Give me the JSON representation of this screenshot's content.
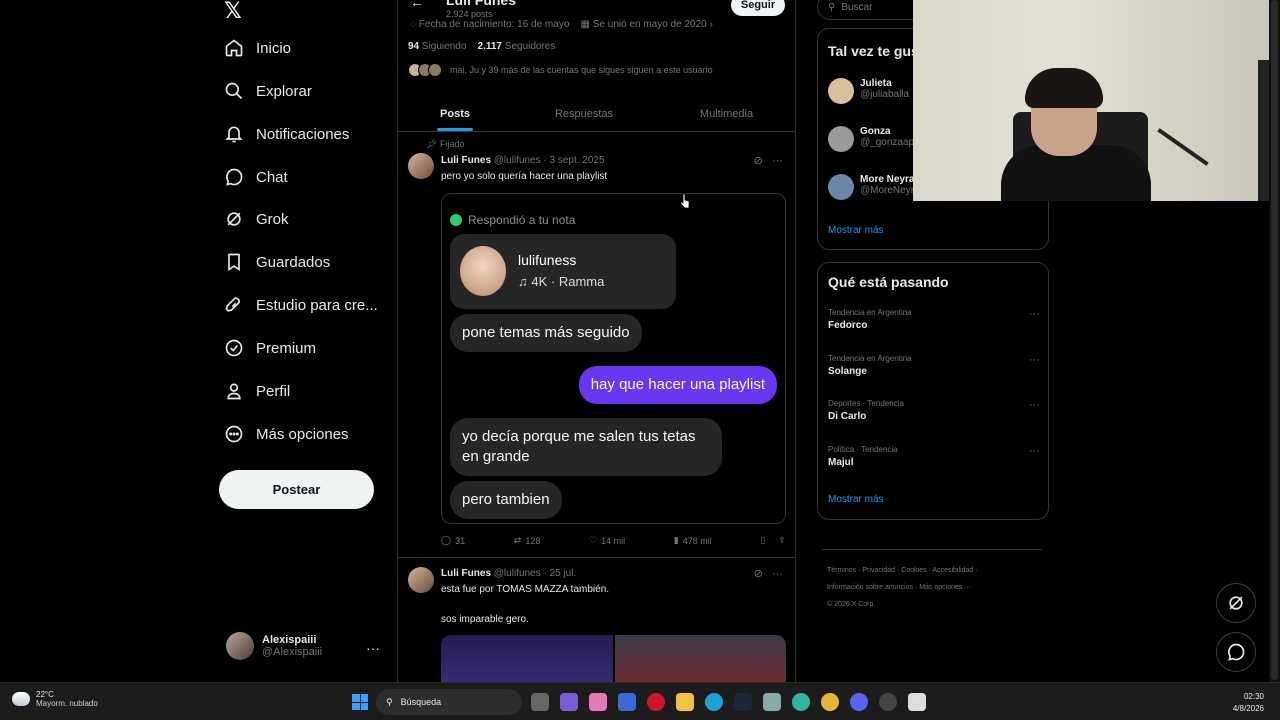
{
  "nav": {
    "items": [
      {
        "label": "Inicio",
        "icon": "home-icon"
      },
      {
        "label": "Explorar",
        "icon": "search-icon"
      },
      {
        "label": "Notificaciones",
        "icon": "bell-icon"
      },
      {
        "label": "Chat",
        "icon": "chat-icon"
      },
      {
        "label": "Grok",
        "icon": "grok-icon"
      },
      {
        "label": "Guardados",
        "icon": "bookmark-icon"
      },
      {
        "label": "Estudio para cre...",
        "icon": "rocket-icon"
      },
      {
        "label": "Premium",
        "icon": "verified-icon"
      },
      {
        "label": "Perfil",
        "icon": "person-icon"
      },
      {
        "label": "Más opciones",
        "icon": "more-circle-icon"
      }
    ],
    "post_button": "Postear",
    "account": {
      "name": "Alexispaiii",
      "handle": "@Alexispaiii"
    }
  },
  "profile": {
    "name": "Luli Funes",
    "post_count": "2.924 posts",
    "follow_label": "Seguir",
    "birth": "Fecha de nacimiento: 16 de mayo",
    "joined": "Se unió en mayo de 2020",
    "following_count": "94",
    "following_label": "Siguiendo",
    "followers_count": "2.117",
    "followers_label": "Seguidores",
    "known_followers": "mai, Ju y 39 más de las cuentas que sigues siguen a este usuario"
  },
  "tabs": [
    "Posts",
    "Respuestas",
    "Multimedia"
  ],
  "pinned_label": "Fijado",
  "post1": {
    "name": "Luli Funes",
    "handle_date": "@lulifunes · 3 sept. 2025",
    "text": "pero yo solo quería hacer una playlist",
    "media": {
      "replied": "Respondió a tu nota",
      "note_user": "lulifuness",
      "note_song": "4K · Ramma",
      "msg1": "pone temas más seguido",
      "msg2": "hay que hacer una playlist",
      "msg3": "yo decía porque me salen tus tetas en grande",
      "msg4": "pero tambien"
    },
    "replies": "31",
    "reposts": "128",
    "likes": "14 mil",
    "views": "478 mil"
  },
  "post2": {
    "name": "Luli Funes",
    "handle_date": "@lulifunes · 25 jul.",
    "text1": "esta fue por TOMAS MAZZA también.",
    "text2": "sos imparable gero."
  },
  "right": {
    "search_placeholder": "Buscar",
    "suggestions_title": "Tal vez te gus",
    "suggestions": [
      {
        "name": "Julieta",
        "handle": "@juliaballa"
      },
      {
        "name": "Gonza",
        "handle": "@_gonzaap"
      },
      {
        "name": "More Neyra",
        "handle": "@MoreNeyra"
      }
    ],
    "show_more": "Mostrar más",
    "trends_title": "Qué está pasando",
    "trends": [
      {
        "category": "Tendencia en Argentina",
        "name": "Fedorco"
      },
      {
        "category": "Tendencia en Argentina",
        "name": "Solange"
      },
      {
        "category": "Deportes · Tendencia",
        "name": "Di Carlo"
      },
      {
        "category": "Política · Tendencia",
        "name": "Majul"
      }
    ],
    "trends_more": "Mostrar más",
    "footer": {
      "line1": "Términos · Privacidad · Cookies · Accesibilidad ·",
      "line2": "Información sobre anuncios · Más opciones ···",
      "line3": "© 2026 X Corp."
    }
  },
  "taskbar": {
    "temp": "22°C",
    "weather": "Mayorm. nublado",
    "search": "Búsqueda",
    "time": "02:30",
    "date": "4/8/2026"
  },
  "colors": {
    "accent": "#1d9bf0",
    "bubble_blue": "#6a37f0",
    "bg": "#000000"
  }
}
